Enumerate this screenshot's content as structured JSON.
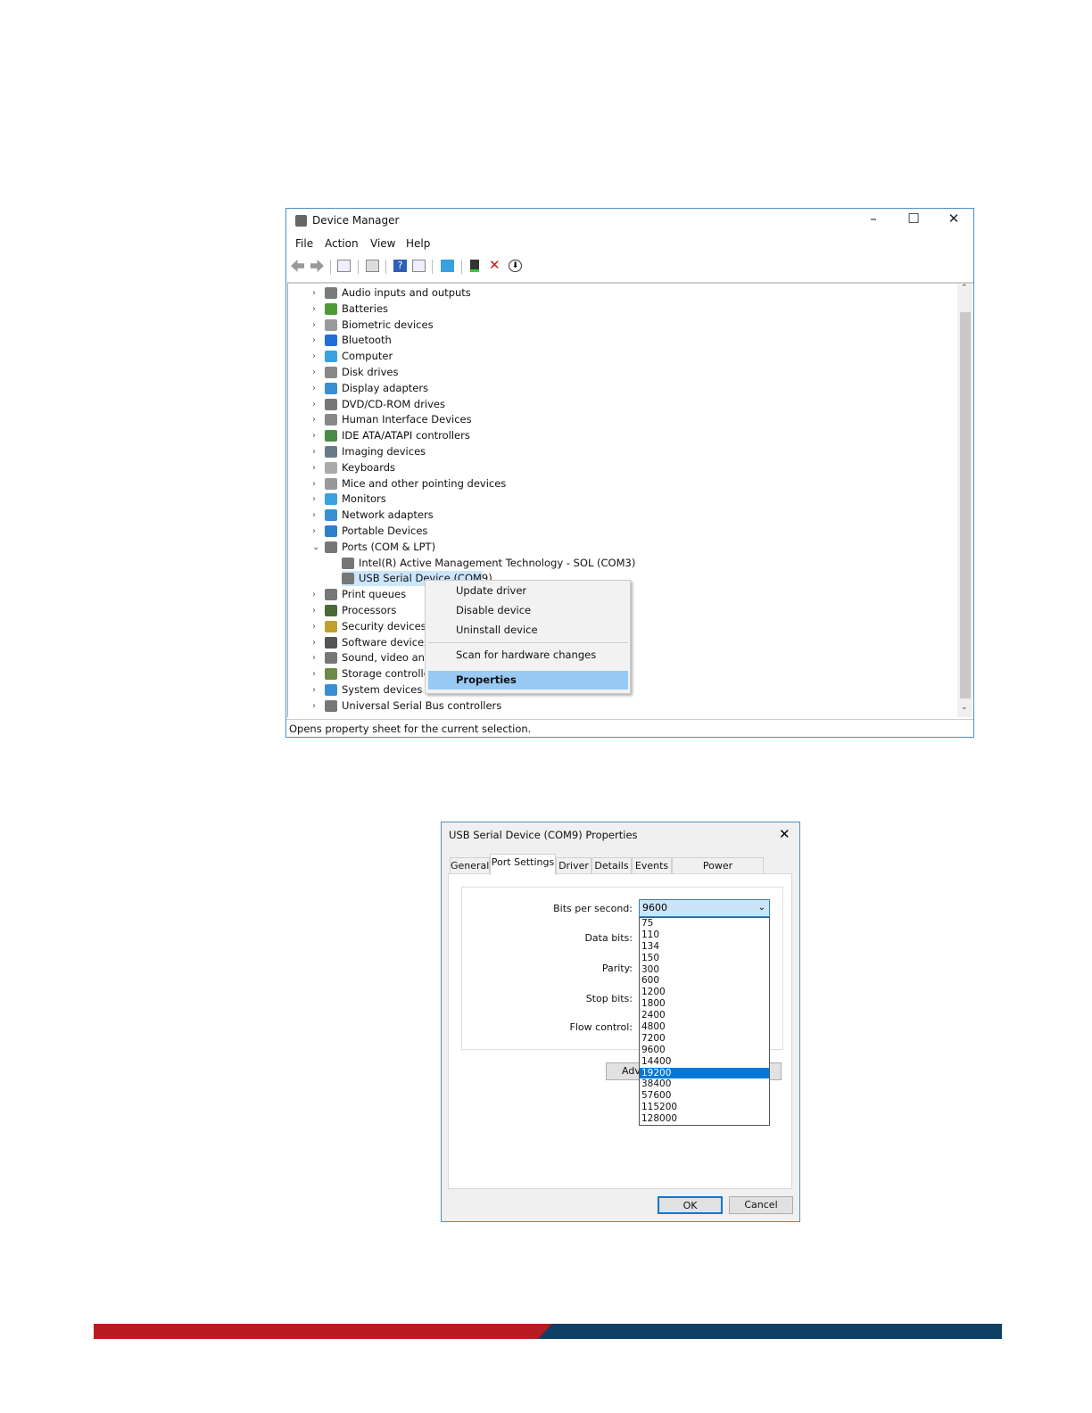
{
  "device_manager": {
    "title": "Device Manager",
    "menu": [
      "File",
      "Action",
      "View",
      "Help"
    ],
    "toolbar_icons": [
      "back-icon",
      "forward-icon",
      "show-hide-console-tree-icon",
      "properties-icon",
      "help-icon",
      "action-pane-icon",
      "monitor-icon",
      "update-driver-icon",
      "uninstall-icon",
      "download-icon"
    ],
    "tree": [
      {
        "label": "Audio inputs and outputs",
        "color": "#7a7a7a"
      },
      {
        "label": "Batteries",
        "color": "#4e9a3a"
      },
      {
        "label": "Biometric devices",
        "color": "#9a9a9a"
      },
      {
        "label": "Bluetooth",
        "color": "#1f6fd6"
      },
      {
        "label": "Computer",
        "color": "#3aa0e0"
      },
      {
        "label": "Disk drives",
        "color": "#888888"
      },
      {
        "label": "Display adapters",
        "color": "#3a8fd0"
      },
      {
        "label": "DVD/CD-ROM drives",
        "color": "#777777"
      },
      {
        "label": "Human Interface Devices",
        "color": "#888888"
      },
      {
        "label": "IDE ATA/ATAPI controllers",
        "color": "#4a8a4a"
      },
      {
        "label": "Imaging devices",
        "color": "#6a7a8a"
      },
      {
        "label": "Keyboards",
        "color": "#aaaaaa"
      },
      {
        "label": "Mice and other pointing devices",
        "color": "#999999"
      },
      {
        "label": "Monitors",
        "color": "#3aa0e0"
      },
      {
        "label": "Network adapters",
        "color": "#3a8fd0"
      },
      {
        "label": "Portable Devices",
        "color": "#2d7fc8"
      },
      {
        "label": "Ports (COM & LPT)",
        "color": "#777777",
        "expanded": true
      },
      {
        "label": "Intel(R) Active Management Technology - SOL (COM3)",
        "color": "#777777",
        "child": true
      },
      {
        "label": "USB Serial Device (COM9)",
        "color": "#777777",
        "child": true,
        "selected": true
      },
      {
        "label": "Print queues",
        "color": "#777777"
      },
      {
        "label": "Processors",
        "color": "#4a6a3a"
      },
      {
        "label": "Security devices",
        "color": "#c0a030"
      },
      {
        "label": "Software devices",
        "color": "#555555"
      },
      {
        "label": "Sound, video and",
        "color": "#777777"
      },
      {
        "label": "Storage controller",
        "color": "#6a8a4a"
      },
      {
        "label": "System devices",
        "color": "#3a8fd0"
      },
      {
        "label": "Universal Serial Bus controllers",
        "color": "#777777"
      }
    ],
    "context_menu": [
      "Update driver",
      "Disable device",
      "Uninstall device",
      "Scan for hardware changes",
      "Properties"
    ],
    "status": "Opens property sheet for the current selection."
  },
  "properties_dialog": {
    "title": "USB Serial Device (COM9) Properties",
    "tabs": [
      "General",
      "Port Settings",
      "Driver",
      "Details",
      "Events",
      "Power Management"
    ],
    "labels": [
      "Bits per second:",
      "Data bits:",
      "Parity:",
      "Stop bits:",
      "Flow control:"
    ],
    "bits_per_second": "9600",
    "options": [
      "75",
      "110",
      "134",
      "150",
      "300",
      "600",
      "1200",
      "1800",
      "2400",
      "4800",
      "7200",
      "9600",
      "14400",
      "19200",
      "38400",
      "57600",
      "115200",
      "128000"
    ],
    "highlighted_option": "19200",
    "advanced_button": "Adv",
    "ok": "OK",
    "cancel": "Cancel"
  },
  "colors": {
    "footer_red": "#b81c22",
    "footer_blue": "#0f3f63",
    "selection": "#0078d7"
  }
}
